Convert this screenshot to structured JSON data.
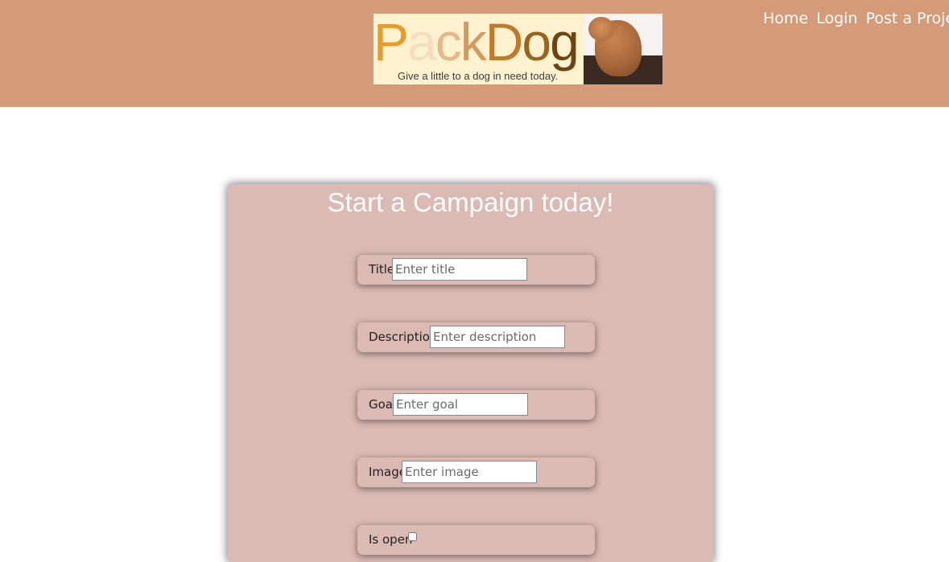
{
  "nav": {
    "items": [
      {
        "label": "Home"
      },
      {
        "label": "Login"
      },
      {
        "label": "Post a Project"
      }
    ]
  },
  "logo": {
    "wordmark": "PackDog",
    "tagline": "Give a little to a dog in need today."
  },
  "form": {
    "title": "Start a Campaign today!",
    "fields": [
      {
        "label": "Title",
        "placeholder": "Enter title",
        "value": ""
      },
      {
        "label": "Description",
        "placeholder": "Enter description",
        "value": ""
      },
      {
        "label": "Goal",
        "placeholder": "Enter goal",
        "value": ""
      },
      {
        "label": "Image",
        "placeholder": "Enter image",
        "value": ""
      },
      {
        "label": "Is open",
        "checked": false
      }
    ]
  },
  "colors": {
    "header_bg": "#d59a78",
    "card_bg": "#dcbab4",
    "nav_text": "#ffffff"
  }
}
